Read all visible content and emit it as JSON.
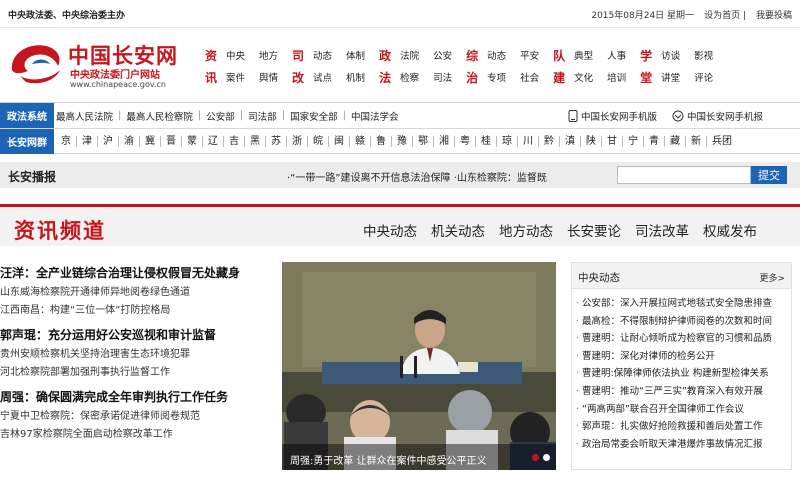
{
  "topbar": {
    "slogan": "中央政法委、中央综治委主办",
    "date": "2015年08月24日",
    "weekday": "星期一",
    "set_home": "设为首页",
    "feedback": "我要投稿"
  },
  "logo": {
    "title": "中国长安网",
    "subtitle": "中央政法委门户网站",
    "url": "www.chinapeace.gov.cn"
  },
  "category_nav": {
    "row1": [
      {
        "head": "资",
        "items": [
          "中央",
          "地方"
        ]
      },
      {
        "head": "司",
        "items": [
          "动态",
          "体制"
        ]
      },
      {
        "head": "政",
        "items": [
          "法院",
          "公安"
        ]
      },
      {
        "head": "综",
        "items": [
          "动态",
          "平安"
        ]
      },
      {
        "head": "队",
        "items": [
          "典型",
          "人事"
        ]
      },
      {
        "head": "学",
        "items": [
          "访谈",
          "影视"
        ]
      }
    ],
    "row2": [
      {
        "head": "讯",
        "items": [
          "案件",
          "舆情"
        ]
      },
      {
        "head": "改",
        "items": [
          "试点",
          "机制"
        ]
      },
      {
        "head": "法",
        "items": [
          "检察",
          "司法"
        ]
      },
      {
        "head": "治",
        "items": [
          "专项",
          "社会"
        ]
      },
      {
        "head": "建",
        "items": [
          "文化",
          "培训"
        ]
      },
      {
        "head": "堂",
        "items": [
          "讲堂",
          "评论"
        ]
      }
    ]
  },
  "political_system": {
    "label": "政法系统",
    "links": [
      "最高人民法院",
      "最高人民检察院",
      "公安部",
      "司法部",
      "国家安全部",
      "中国法学会"
    ],
    "mobile_site": "中国长安网手机版",
    "mobile_paper": "中国长安网手机报"
  },
  "regional": {
    "label": "长安网群",
    "provinces": [
      "京",
      "津",
      "沪",
      "渝",
      "冀",
      "晋",
      "蒙",
      "辽",
      "吉",
      "黑",
      "苏",
      "浙",
      "皖",
      "闽",
      "赣",
      "鲁",
      "豫",
      "鄂",
      "湘",
      "粤",
      "桂",
      "琼",
      "川",
      "黔",
      "滇",
      "陕",
      "甘",
      "宁",
      "青",
      "藏",
      "新",
      "兵团"
    ]
  },
  "broadcast": {
    "title": "长安播报",
    "news_text": "·“一带一路”建设离不开信息法治保障  ·山东检察院：监督既",
    "search_button": "提交"
  },
  "channel": {
    "title": "资讯频道",
    "tabs": [
      "中央动态",
      "机关动态",
      "地方动态",
      "长安要论",
      "司法改革",
      "权威发布"
    ]
  },
  "left_news": [
    {
      "headline": "汪洋：全产业链综合治理让侵权假冒无处藏身",
      "subs": [
        "山东威海检察院开通律师异地阅卷绿色通道",
        "江西南昌：构建“三位一体”打防控格局"
      ]
    },
    {
      "headline": "郭声琨：充分运用好公安巡视和审计监督",
      "subs": [
        "贵州安顺检察机关坚持治理害生态环境犯罪",
        "河北检察院部署加强刑事执行监督工作"
      ]
    },
    {
      "headline": "周强：确保圆满完成全年审判执行工作任务",
      "subs": [
        "宁夏中卫检察院：保密承诺促进律师阅卷规范",
        "吉林97家检察院全面启动检察改革工作"
      ]
    }
  ],
  "photo": {
    "caption": "周强:勇于改革 让群众在案件中感受公平正义",
    "active_slide": 1,
    "slide_count": 2
  },
  "right_panel": {
    "title": "中央动态",
    "more": "更多>",
    "items": [
      "公安部：深入开展拉网式地毯式安全隐患排查",
      "最高检：不得限制辩护律师阅卷的次数和时间",
      "曹建明：让耐心倾听成为检察官的习惯和品质",
      "曹建明：深化对律师的检务公开",
      "曹建明:保障律师依法执业 构建新型检律关系",
      "曹建明：推动“三严三实”教育深入有效开展",
      "“两高两部”联合召开全国律师工作会议",
      "郭声琨：扎实做好抢险救援和善后处置工作",
      "政治局常委会听取天津港爆炸事故情况汇报"
    ]
  },
  "colors": {
    "brand_red": "#c4161c",
    "brand_blue": "#1d64b4"
  }
}
